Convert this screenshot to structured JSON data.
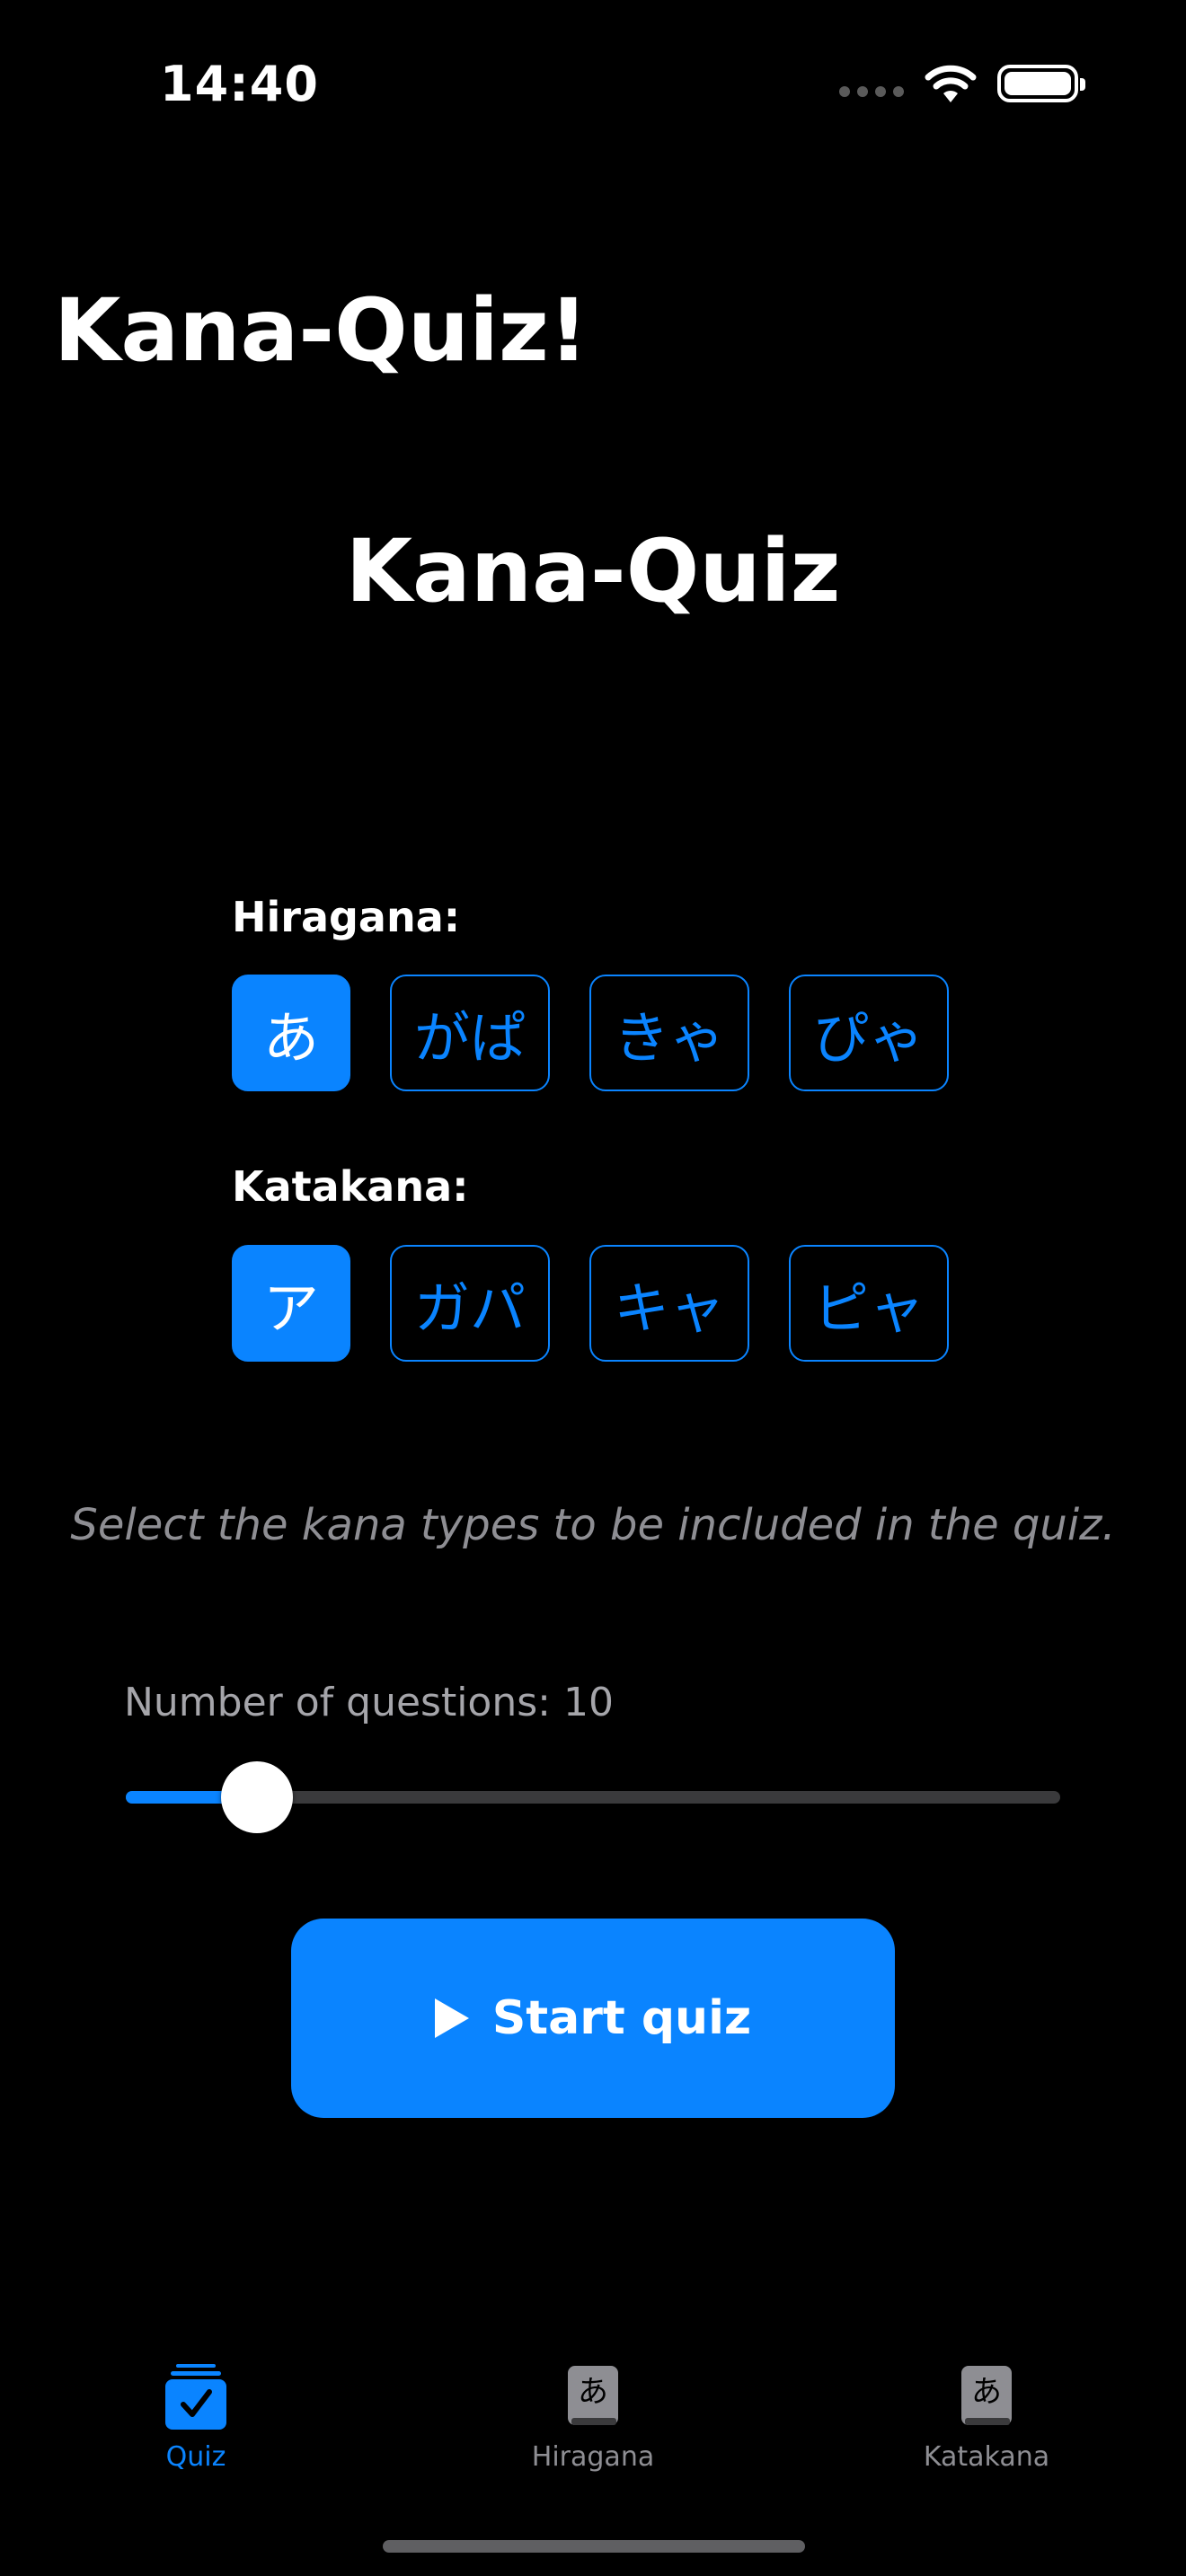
{
  "status_bar": {
    "time": "14:40"
  },
  "nav": {
    "title": "Kana-Quiz!"
  },
  "main": {
    "title": "Kana-Quiz",
    "hiragana": {
      "label": "Hiragana:",
      "options": [
        {
          "text": "あ",
          "selected": true
        },
        {
          "text": "がぱ",
          "selected": false
        },
        {
          "text": "きゃ",
          "selected": false
        },
        {
          "text": "ぴゃ",
          "selected": false
        }
      ]
    },
    "katakana": {
      "label": "Katakana:",
      "options": [
        {
          "text": "ア",
          "selected": true
        },
        {
          "text": "ガパ",
          "selected": false
        },
        {
          "text": "キャ",
          "selected": false
        },
        {
          "text": "ピャ",
          "selected": false
        }
      ]
    },
    "hint": "Select the kana types to be included in the quiz.",
    "questions": {
      "label": "Number of questions: 10",
      "value": 10,
      "fraction": 0.14
    },
    "start_button": {
      "label": "Start quiz",
      "icon": "play-icon"
    }
  },
  "tab_bar": {
    "tabs": [
      {
        "label": "Quiz",
        "icon": "quiz-checklist-icon",
        "active": true
      },
      {
        "label": "Hiragana",
        "icon": "hiragana-book-icon",
        "active": false
      },
      {
        "label": "Katakana",
        "icon": "katakana-book-icon",
        "active": false
      }
    ]
  },
  "colors": {
    "accent": "#0a84ff",
    "background": "#000000",
    "secondary_text": "#8e8e93"
  }
}
